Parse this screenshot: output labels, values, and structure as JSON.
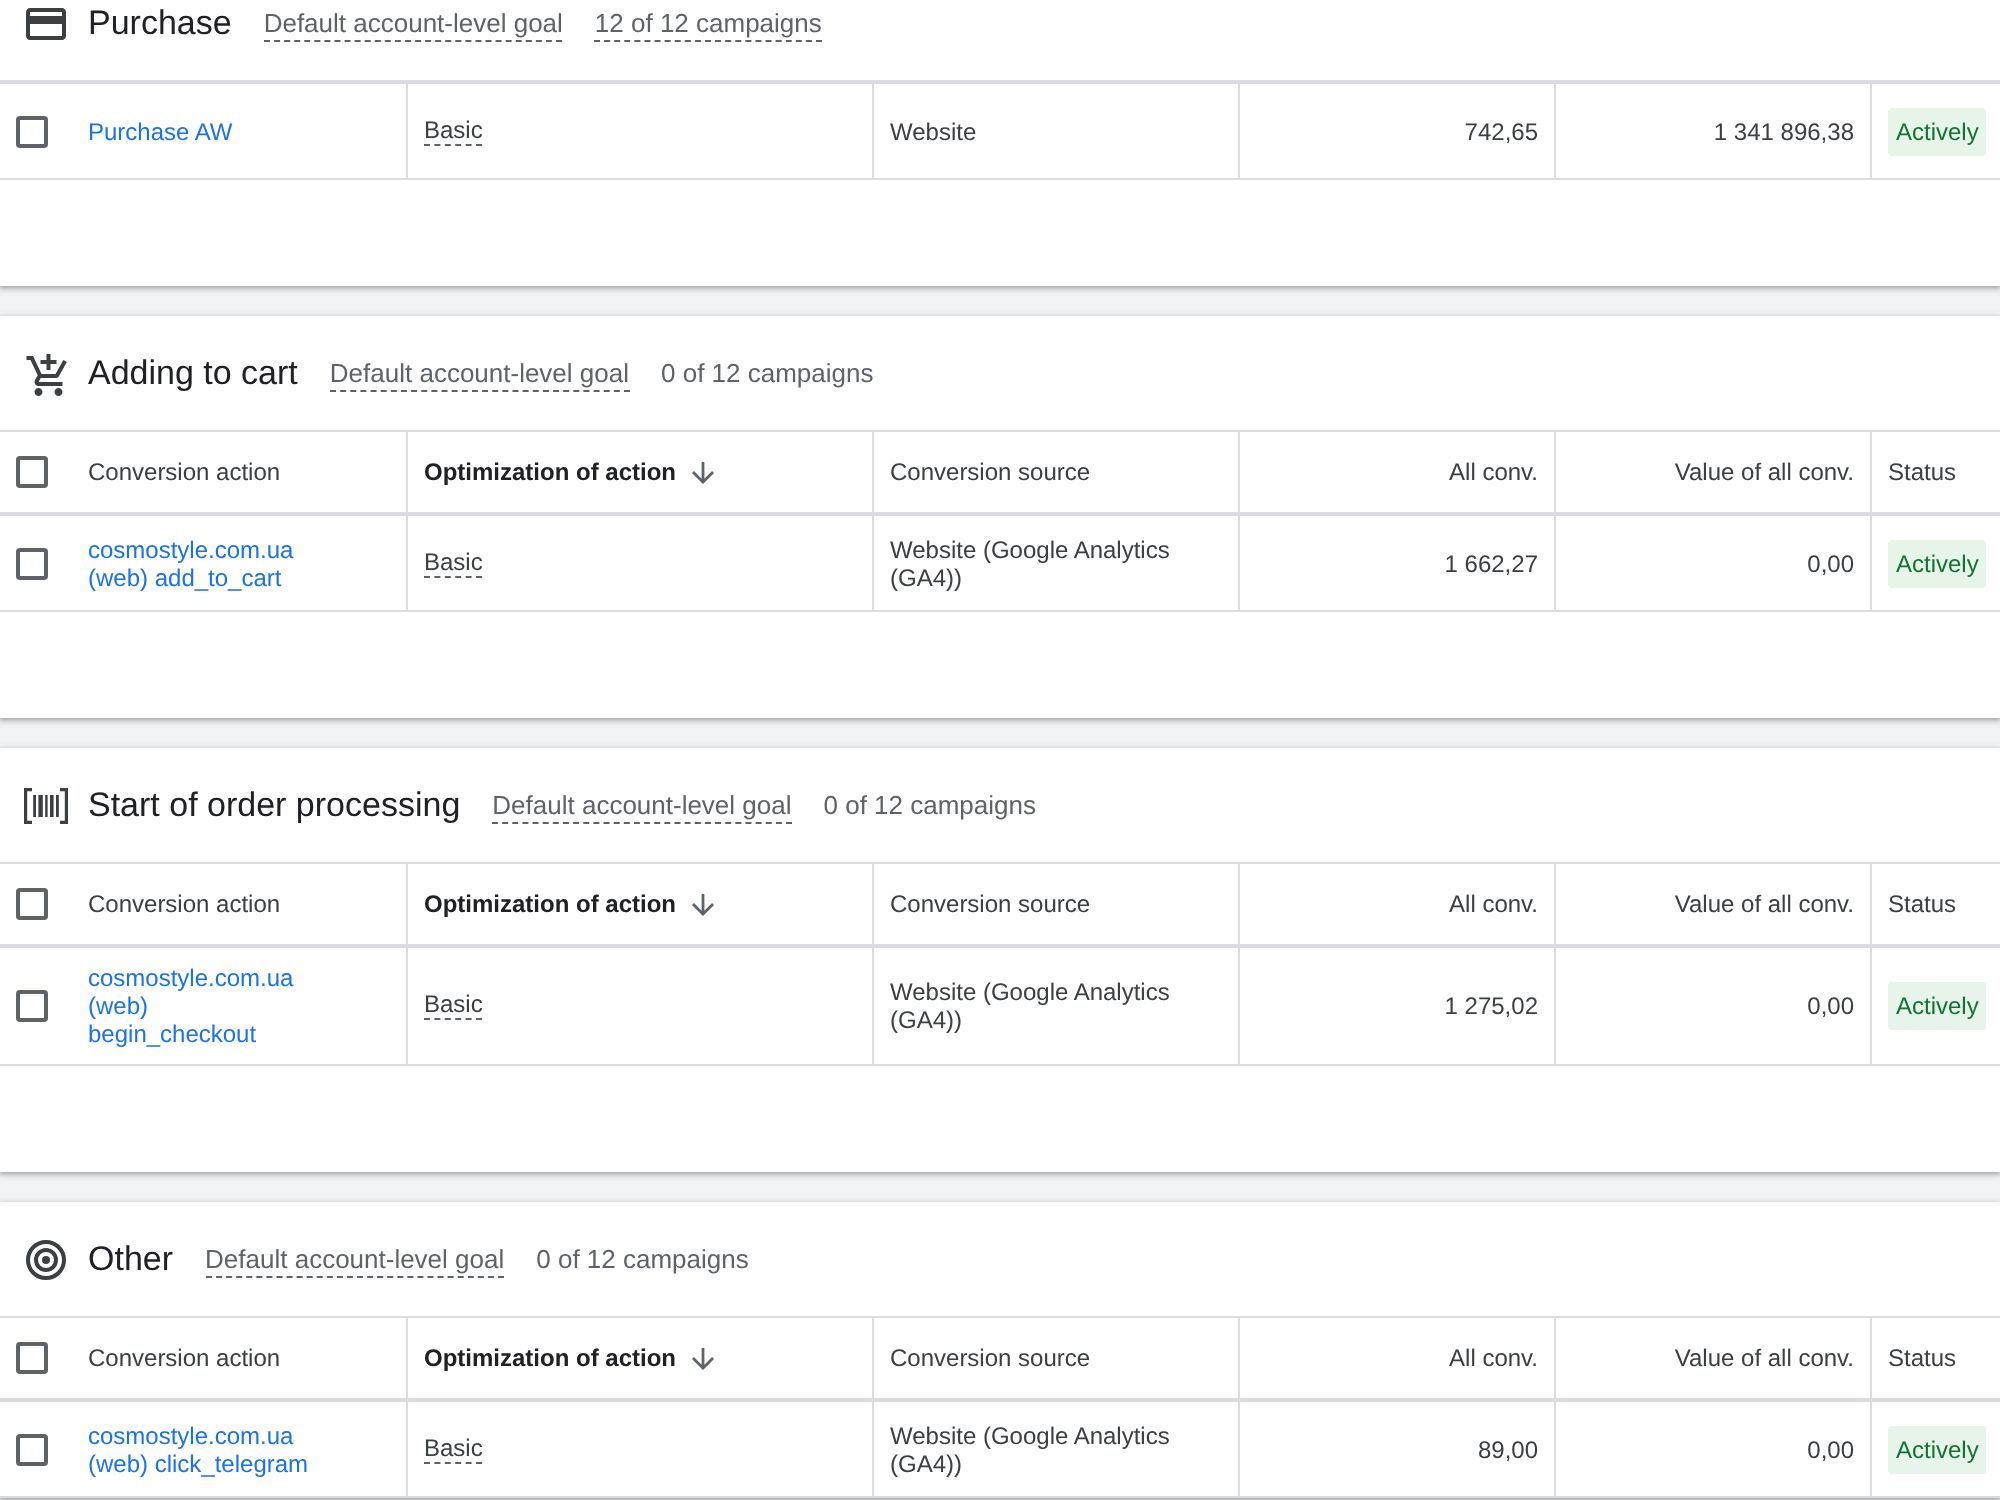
{
  "goals": [
    {
      "kind": "purchase",
      "title": "Purchase",
      "goal_type": "Default account-level goal",
      "campaigns": "12 of 12 campaigns",
      "campaigns_underlined": true,
      "rows": [
        {
          "checked": false,
          "conversion_action": "Purchase AW",
          "optimization": "Basic",
          "source": "Website",
          "all_conv": "742,65",
          "value_of_all_conv": "1 341 896,38",
          "status": "Actively"
        }
      ]
    },
    {
      "kind": "add_to_cart",
      "title": "Adding to cart",
      "goal_type": "Default account-level goal",
      "campaigns": "0 of 12 campaigns",
      "campaigns_underlined": false,
      "header_checked": false,
      "columns": [
        {
          "label": "Conversion action",
          "sorted": false
        },
        {
          "label": "Optimization of action",
          "sorted": true
        },
        {
          "label": "Conversion source",
          "sorted": false
        },
        {
          "label": "All conv.",
          "sorted": false
        },
        {
          "label": "Value of all conv.",
          "sorted": false
        },
        {
          "label": "Status",
          "sorted": false
        }
      ],
      "rows": [
        {
          "checked": false,
          "conversion_action": "cosmostyle.com.ua (web) add_to_cart",
          "optimization": "Basic",
          "source": "Website (Google Analytics (GA4))",
          "all_conv": "1 662,27",
          "value_of_all_conv": "0,00",
          "status": "Actively"
        }
      ]
    },
    {
      "kind": "begin_checkout",
      "title": "Start of order processing",
      "goal_type": "Default account-level goal",
      "campaigns": "0 of 12 campaigns",
      "campaigns_underlined": false,
      "header_checked": false,
      "columns": [
        {
          "label": "Conversion action",
          "sorted": false
        },
        {
          "label": "Optimization of action",
          "sorted": true
        },
        {
          "label": "Conversion source",
          "sorted": false
        },
        {
          "label": "All conv.",
          "sorted": false
        },
        {
          "label": "Value of all conv.",
          "sorted": false
        },
        {
          "label": "Status",
          "sorted": false
        }
      ],
      "rows": [
        {
          "checked": false,
          "conversion_action": "cosmostyle.com.ua (web) begin_checkout",
          "optimization": "Basic",
          "source": "Website (Google Analytics (GA4))",
          "all_conv": "1 275,02",
          "value_of_all_conv": "0,00",
          "status": "Actively"
        }
      ]
    },
    {
      "kind": "other",
      "title": "Other",
      "goal_type": "Default account-level goal",
      "campaigns": "0 of 12 campaigns",
      "campaigns_underlined": false,
      "header_checked": false,
      "columns": [
        {
          "label": "Conversion action",
          "sorted": false
        },
        {
          "label": "Optimization of action",
          "sorted": true
        },
        {
          "label": "Conversion source",
          "sorted": false
        },
        {
          "label": "All conv.",
          "sorted": false
        },
        {
          "label": "Value of all conv.",
          "sorted": false
        },
        {
          "label": "Status",
          "sorted": false
        }
      ],
      "rows": [
        {
          "checked": false,
          "conversion_action": "cosmostyle.com.ua (web) click_telegram",
          "optimization": "Basic",
          "source": "Website (Google Analytics (GA4))",
          "all_conv": "89,00",
          "value_of_all_conv": "0,00",
          "status": "Actively"
        }
      ]
    }
  ]
}
